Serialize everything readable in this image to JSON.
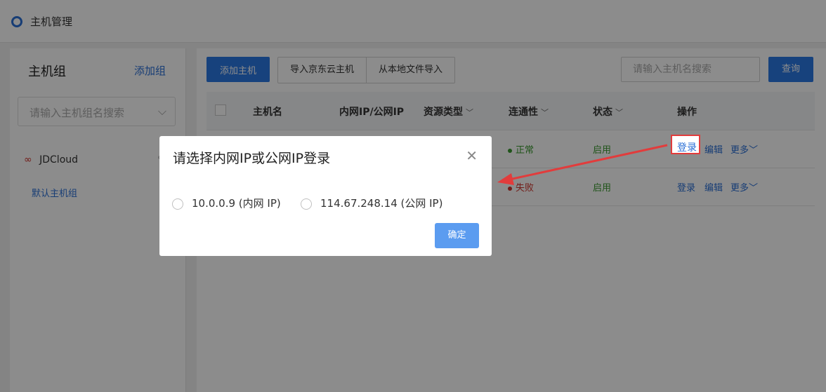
{
  "header": {
    "title": "主机管理"
  },
  "sidebar": {
    "title": "主机组",
    "add_label": "添加组",
    "search_placeholder": "请输入主机组名搜索",
    "groups": [
      {
        "name": "JDCloud",
        "sub": "默认主机组"
      }
    ]
  },
  "toolbar": {
    "add_host": "添加主机",
    "import_jd": "导入京东云主机",
    "import_file": "从本地文件导入",
    "search_placeholder": "请输入主机名搜索",
    "query": "查询"
  },
  "table": {
    "columns": [
      "主机名",
      "内网IP/公网IP",
      "资源类型",
      "连通性",
      "状态",
      "操作"
    ],
    "rows": [
      {
        "connectivity": "正常",
        "status": "启用",
        "actions": [
          "登录",
          "编辑",
          "更多"
        ]
      },
      {
        "connectivity": "失败",
        "status": "启用",
        "actions": [
          "登录",
          "编辑",
          "更多"
        ]
      }
    ]
  },
  "dialog": {
    "title": "请选择内网IP或公网IP登录",
    "options": [
      "10.0.0.9 (内网 IP)",
      "114.67.248.14 (公网 IP)"
    ],
    "confirm": "确定"
  },
  "colors": {
    "primary": "#2b78e4",
    "ok": "#3a9a2e",
    "fail": "#d0342c",
    "annotation": "#e23c3c"
  }
}
